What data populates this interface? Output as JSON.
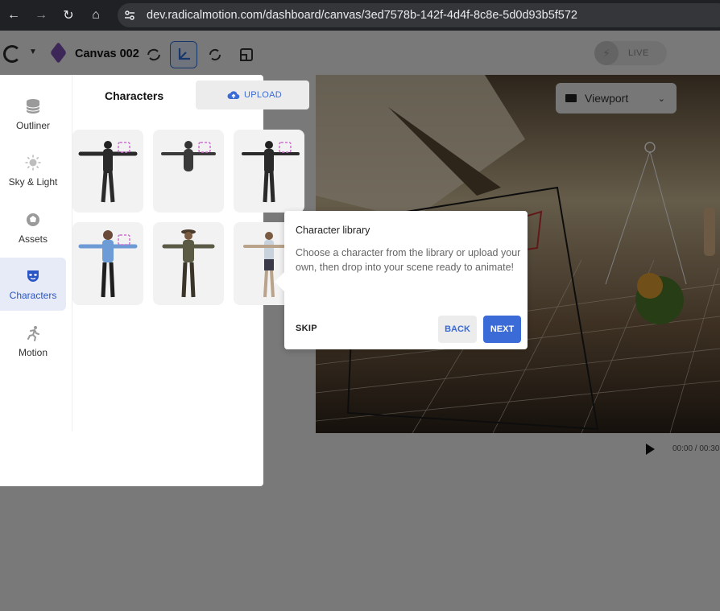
{
  "browser": {
    "url": "dev.radicalmotion.com/dashboard/canvas/3ed7578b-142f-4d4f-8c8e-5d0d93b5f572"
  },
  "toolbar": {
    "canvas_name": "Canvas 002",
    "live_label": "LIVE"
  },
  "sidenav": {
    "items": [
      {
        "label": "Outliner",
        "icon": "database-icon"
      },
      {
        "label": "Sky & Light",
        "icon": "sun-icon"
      },
      {
        "label": "Assets",
        "icon": "assets-icon"
      },
      {
        "label": "Characters",
        "icon": "mask-icon",
        "active": true
      },
      {
        "label": "Motion",
        "icon": "running-person-icon"
      }
    ]
  },
  "library": {
    "title": "Characters",
    "upload_label": "UPLOAD"
  },
  "viewport": {
    "select_label": "Viewport",
    "time": "00:00 / 00:30"
  },
  "tooltip": {
    "title": "Character library",
    "body": "Choose a character from the library or upload your own, then drop into your scene ready to animate!",
    "skip_label": "SKIP",
    "back_label": "BACK",
    "next_label": "NEXT"
  },
  "colors": {
    "accent": "#3a6bd6",
    "scan_badge": "#d070d0"
  }
}
